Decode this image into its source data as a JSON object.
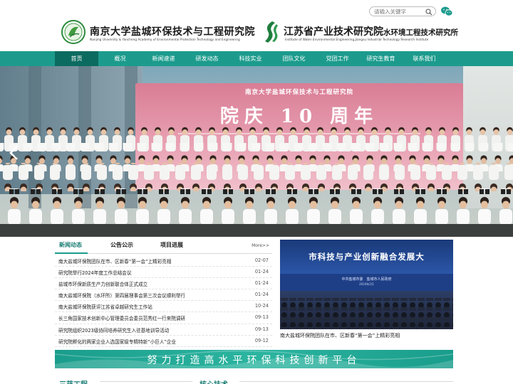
{
  "header": {
    "left_logo": {
      "title": "南京大学盐城环保技术与工程研究院",
      "subtitle": "Nanjing University & Yancheng Academy of Environmental Protection Technology and Engineering"
    },
    "right_logo": {
      "title_main": "江苏省产业技术研究院",
      "title_small": "水环境工程技术研究所",
      "subtitle": "Institute of Water Environmental Engineering,Jiangsu Industrial Technology Research Institute"
    },
    "search": {
      "placeholder": "请输入关键字",
      "icon": "search-icon"
    },
    "wechat_icon": "wechat-icon"
  },
  "nav": {
    "items": [
      {
        "label": "首页",
        "active": true
      },
      {
        "label": "概况"
      },
      {
        "label": "新闻速递"
      },
      {
        "label": "研发动态"
      },
      {
        "label": "科技实业"
      },
      {
        "label": "团队文化"
      },
      {
        "label": "党团工作"
      },
      {
        "label": "研究生教育"
      },
      {
        "label": "联系我们"
      }
    ]
  },
  "banner": {
    "backdrop_title": "南京大学盐城环保技术与工程研究院",
    "backdrop_big": "院庆 10 周年",
    "prev_icon": "chevron-left-icon"
  },
  "news": {
    "tabs": [
      "新闻动态",
      "公告公示",
      "项目进展"
    ],
    "active_tab": 0,
    "more": "More>>",
    "items": [
      {
        "title": "南大盐城环保院团队在市、区新春“第一会”上精彩亮相",
        "date": "02-07"
      },
      {
        "title": "研究院举行2024年度工作总结会议",
        "date": "01-24"
      },
      {
        "title": "盐城市环保新质生产力创新联合体正式成立",
        "date": "01-24"
      },
      {
        "title": "南大盐城环保院（水环所）第四届理事会第三次会议顺利举行",
        "date": "01-24"
      },
      {
        "title": "南大盐城环保院获评江苏省卓越研究生工作站",
        "date": "10-24"
      },
      {
        "title": "长三角国家技术创新中心管理委员会委员范秀红一行来院调研",
        "date": "09-13"
      },
      {
        "title": "研究院组织2023级协同培养研究生入驻基地训导活动",
        "date": "09-13"
      },
      {
        "title": "研究院孵化的两家企业入选国家级专精特新“小巨人”企业",
        "date": "09-12"
      }
    ]
  },
  "feature": {
    "banner_text": "市科技与产业创新融合发展大",
    "sub1": "中共盐城市委　盐城市人民政府",
    "sub2": "2024年2月",
    "caption": "南大盐城环保院团队在市、区新春“第一会”上精彩亮相"
  },
  "slogan": "努力打造高水平环保科技创新平台",
  "sections": [
    "三蓝工程",
    "核心技术"
  ],
  "colors": {
    "accent": "#1c9b8d",
    "nav_active": "#0c6b60",
    "tab_active": "#1c7f75"
  }
}
